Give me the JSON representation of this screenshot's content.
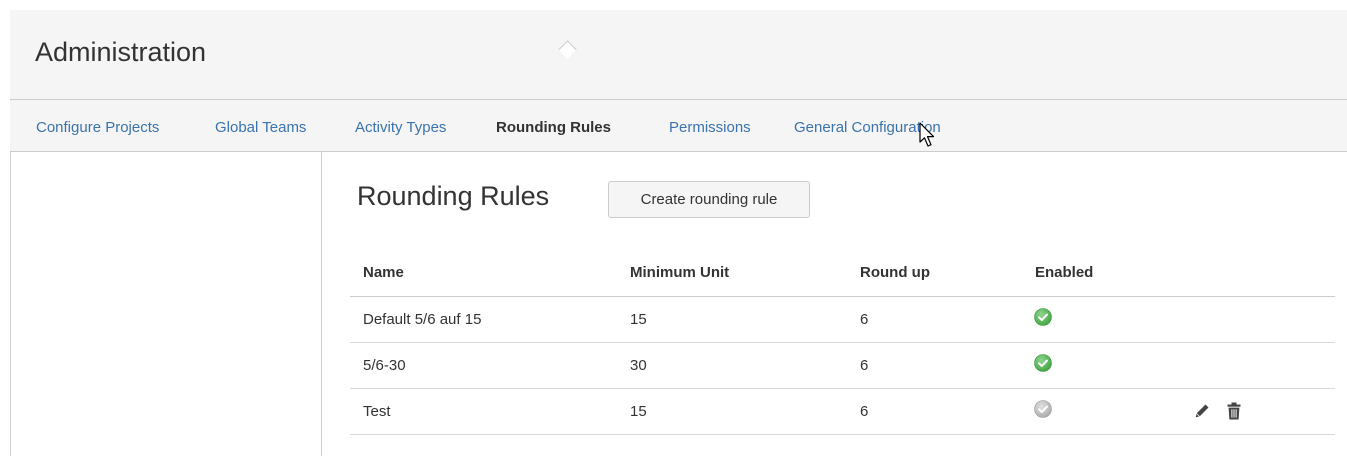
{
  "header": {
    "title": "Administration"
  },
  "nav": {
    "items": [
      {
        "label": "Configure Projects"
      },
      {
        "label": "Global Teams"
      },
      {
        "label": "Activity Types"
      },
      {
        "label": "Rounding Rules"
      },
      {
        "label": "Permissions"
      },
      {
        "label": "General Configuration"
      }
    ],
    "active": "Rounding Rules"
  },
  "main": {
    "title": "Rounding Rules",
    "create_button": "Create rounding rule"
  },
  "table": {
    "columns": [
      "Name",
      "Minimum Unit",
      "Round up",
      "Enabled"
    ],
    "rows": [
      {
        "name": "Default 5/6 auf 15",
        "minimum_unit": "15",
        "round_up": "6",
        "enabled": true,
        "actions": false
      },
      {
        "name": "5/6-30",
        "minimum_unit": "30",
        "round_up": "6",
        "enabled": true,
        "actions": false
      },
      {
        "name": "Test",
        "minimum_unit": "15",
        "round_up": "6",
        "enabled": false,
        "actions": true
      }
    ]
  },
  "colors": {
    "link": "#3b73af",
    "enabled": "#59b359",
    "disabled": "#bbbbbb",
    "text": "#333333"
  },
  "icons": {
    "enabled": "check-circle-icon",
    "disabled": "check-circle-disabled-icon",
    "edit": "pencil-icon",
    "delete": "trash-icon",
    "cursor": "mouse-pointer-icon"
  }
}
